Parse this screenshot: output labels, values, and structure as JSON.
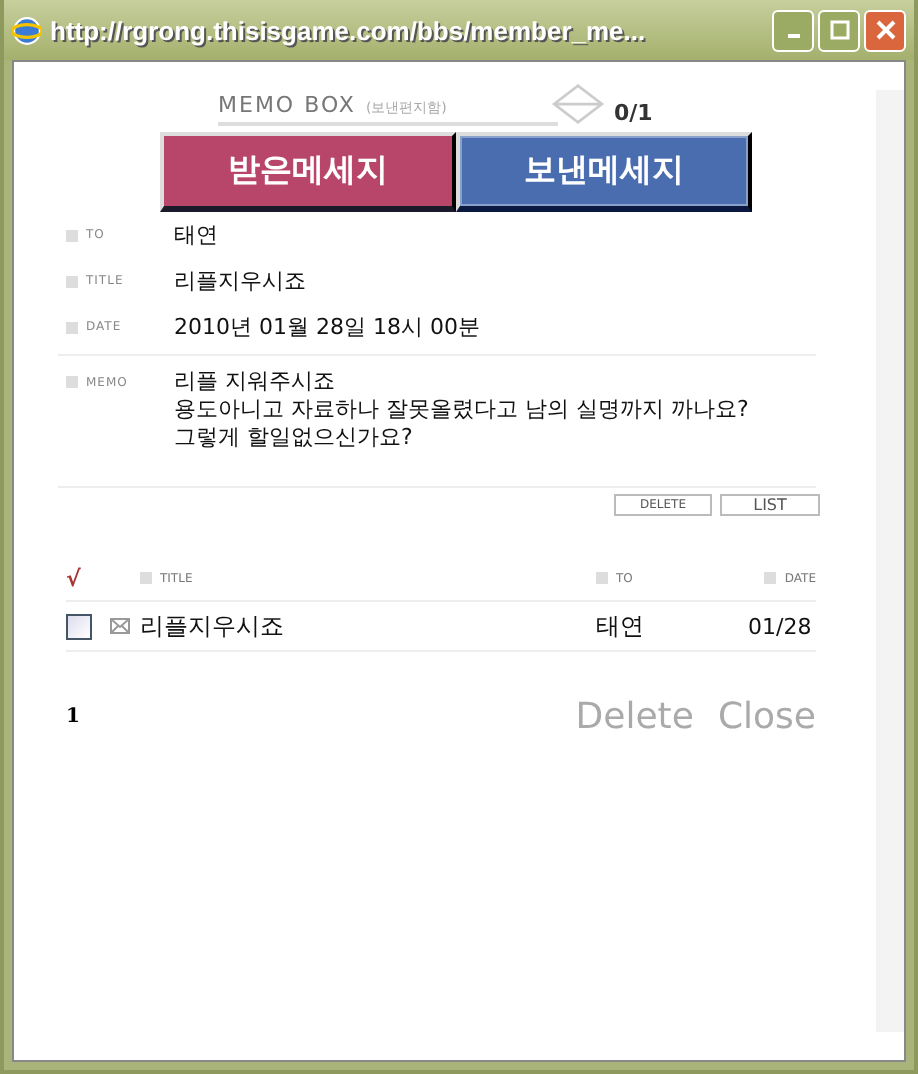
{
  "window": {
    "title": "http://rgrong.thisisgame.com/bbs/member_me..."
  },
  "header": {
    "title": "MEMO BOX",
    "subtitle": "(보낸편지함)",
    "count": "0/1"
  },
  "tabs": [
    {
      "label": "받은메세지",
      "selected": false,
      "color": "#b8456a"
    },
    {
      "label": "보낸메세지",
      "selected": true,
      "color": "#4a6db0"
    }
  ],
  "fields": [
    {
      "label": "TO",
      "value": "태연"
    },
    {
      "label": "TITLE",
      "value": "리플지우시죠"
    },
    {
      "label": "DATE",
      "value": "2010년 01월 28일 18시 00분"
    }
  ],
  "memo": {
    "label": "MEMO",
    "lines": [
      "리플 지워주시죠",
      "용도아니고 자료하나 잘못올렸다고 남의 실명까지 까나요?",
      "그렇게 할일없으신가요?"
    ]
  },
  "actions": [
    "DELETE",
    "LIST"
  ],
  "list": {
    "columns": [
      "√",
      "TITLE",
      "TO",
      "DATE"
    ],
    "rows": [
      {
        "checked": false,
        "title": "리플지우시죠",
        "to": "태연",
        "date": "01/28"
      }
    ]
  },
  "pager": "1",
  "buttons": [
    "Delete",
    "Close"
  ]
}
